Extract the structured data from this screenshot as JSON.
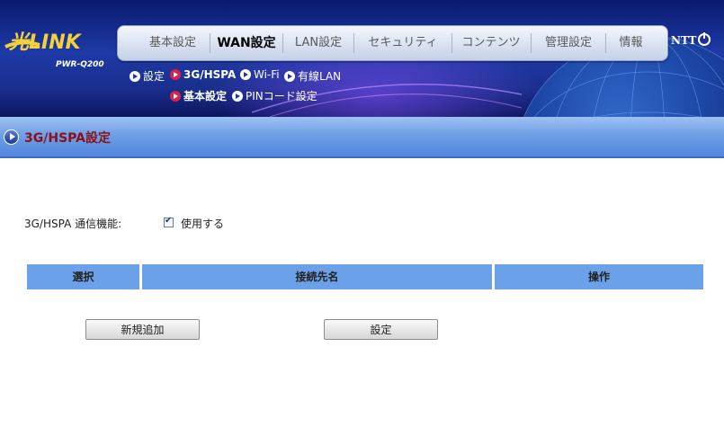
{
  "brand": {
    "logo": "光LINK",
    "model": "PWR-Q200",
    "vendor": "NTT"
  },
  "nav": [
    {
      "label": "基本設定"
    },
    {
      "label": "WAN設定",
      "active": true
    },
    {
      "label": "LAN設定"
    },
    {
      "label": "セキュリティ"
    },
    {
      "label": "コンテンツ"
    },
    {
      "label": "管理設定"
    },
    {
      "label": "情報"
    }
  ],
  "subnav1": [
    "設定",
    "3G/HSPA",
    "Wi-Fi",
    "有線LAN"
  ],
  "subnav2": [
    "基本設定",
    "PINコード設定"
  ],
  "section": {
    "title": "3G/HSPA設定"
  },
  "form": {
    "label": "3G/HSPA 通信機能:",
    "checkbox_label": "使用する",
    "checked": true
  },
  "table": {
    "headers": [
      "選択",
      "接続先名",
      "操作"
    ]
  },
  "buttons": {
    "add": "新規追加",
    "apply": "設定"
  }
}
